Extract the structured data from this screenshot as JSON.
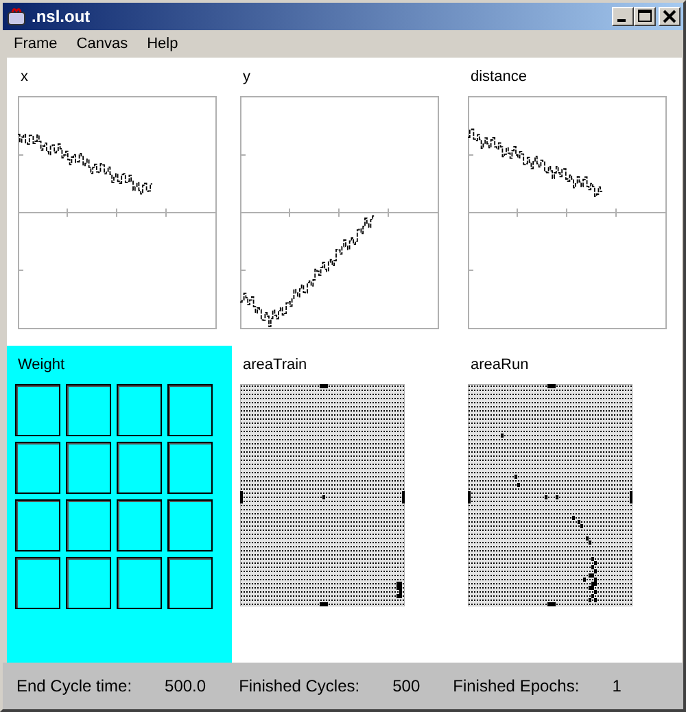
{
  "window": {
    "title": ".nsl.out"
  },
  "menu": [
    "Frame",
    "Canvas",
    "Help"
  ],
  "plots": [
    {
      "title": "x",
      "kind": "upper"
    },
    {
      "title": "y",
      "kind": "lower"
    },
    {
      "title": "distance",
      "kind": "upper"
    }
  ],
  "weight": {
    "title": "Weight"
  },
  "areas": [
    {
      "title": "areaTrain",
      "kind": "train"
    },
    {
      "title": "areaRun",
      "kind": "run"
    }
  ],
  "status": [
    {
      "label": "End Cycle time:",
      "value": "500.0"
    },
    {
      "label": "Finished Cycles:",
      "value": "500"
    },
    {
      "label": "Finished Epochs:",
      "value": "1"
    }
  ]
}
